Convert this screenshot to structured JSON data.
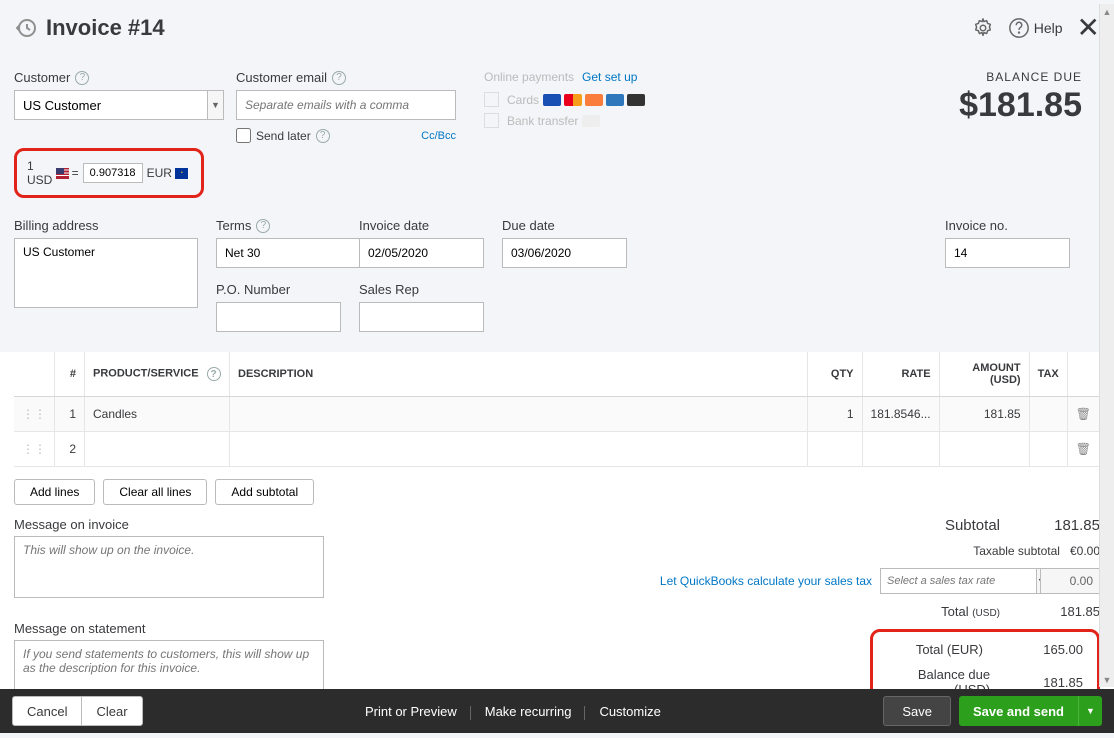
{
  "header": {
    "title": "Invoice #14",
    "help": "Help"
  },
  "customer": {
    "label": "Customer",
    "value": "US Customer",
    "emailLabel": "Customer email",
    "emailPlaceholder": "Separate emails with a comma",
    "sendLater": "Send later",
    "ccbcc": "Cc/Bcc"
  },
  "exchange": {
    "left": "1 USD",
    "rate": "0.907318",
    "right": "EUR"
  },
  "payments": {
    "headLabel": "Online payments",
    "setup": "Get set up",
    "cards": "Cards",
    "bank": "Bank transfer"
  },
  "balance": {
    "label": "BALANCE DUE",
    "amount": "$181.85"
  },
  "fields": {
    "billingAddress": {
      "label": "Billing address",
      "value": "US Customer"
    },
    "terms": {
      "label": "Terms",
      "value": "Net 30"
    },
    "invoiceDate": {
      "label": "Invoice date",
      "value": "02/05/2020"
    },
    "dueDate": {
      "label": "Due date",
      "value": "03/06/2020"
    },
    "invoiceNo": {
      "label": "Invoice no.",
      "value": "14"
    },
    "poNumber": {
      "label": "P.O. Number",
      "value": ""
    },
    "salesRep": {
      "label": "Sales Rep",
      "value": ""
    }
  },
  "table": {
    "headers": {
      "num": "#",
      "product": "PRODUCT/SERVICE",
      "desc": "DESCRIPTION",
      "qty": "QTY",
      "rate": "RATE",
      "amount": "AMOUNT (USD)",
      "tax": "TAX"
    },
    "rows": [
      {
        "num": "1",
        "product": "Candles",
        "desc": "",
        "qty": "1",
        "rate": "181.8546...",
        "amount": "181.85"
      },
      {
        "num": "2",
        "product": "",
        "desc": "",
        "qty": "",
        "rate": "",
        "amount": ""
      }
    ]
  },
  "buttons": {
    "addLines": "Add lines",
    "clearLines": "Clear all lines",
    "addSubtotal": "Add subtotal"
  },
  "messages": {
    "invoice": {
      "label": "Message on invoice",
      "placeholder": "This will show up on the invoice."
    },
    "statement": {
      "label": "Message on statement",
      "placeholder": "If you send statements to customers, this will show up as the description for this invoice."
    }
  },
  "totals": {
    "subtotalLabel": "Subtotal",
    "subtotal": "181.85",
    "taxableLabel": "Taxable subtotal",
    "taxable": "€0.00",
    "taxLink": "Let QuickBooks calculate your sales tax",
    "taxSelectPlaceholder": "Select a sales tax rate",
    "taxAmount": "0.00",
    "totalUsdLabel": "Total (USD)",
    "totalUsd": "181.85",
    "totalEurLabel": "Total (EUR)",
    "totalEur": "165.00",
    "balanceLabel": "Balance due (USD)",
    "balance": "181.85"
  },
  "footer": {
    "cancel": "Cancel",
    "clear": "Clear",
    "print": "Print or Preview",
    "recurring": "Make recurring",
    "customize": "Customize",
    "save": "Save",
    "send": "Save and send"
  }
}
